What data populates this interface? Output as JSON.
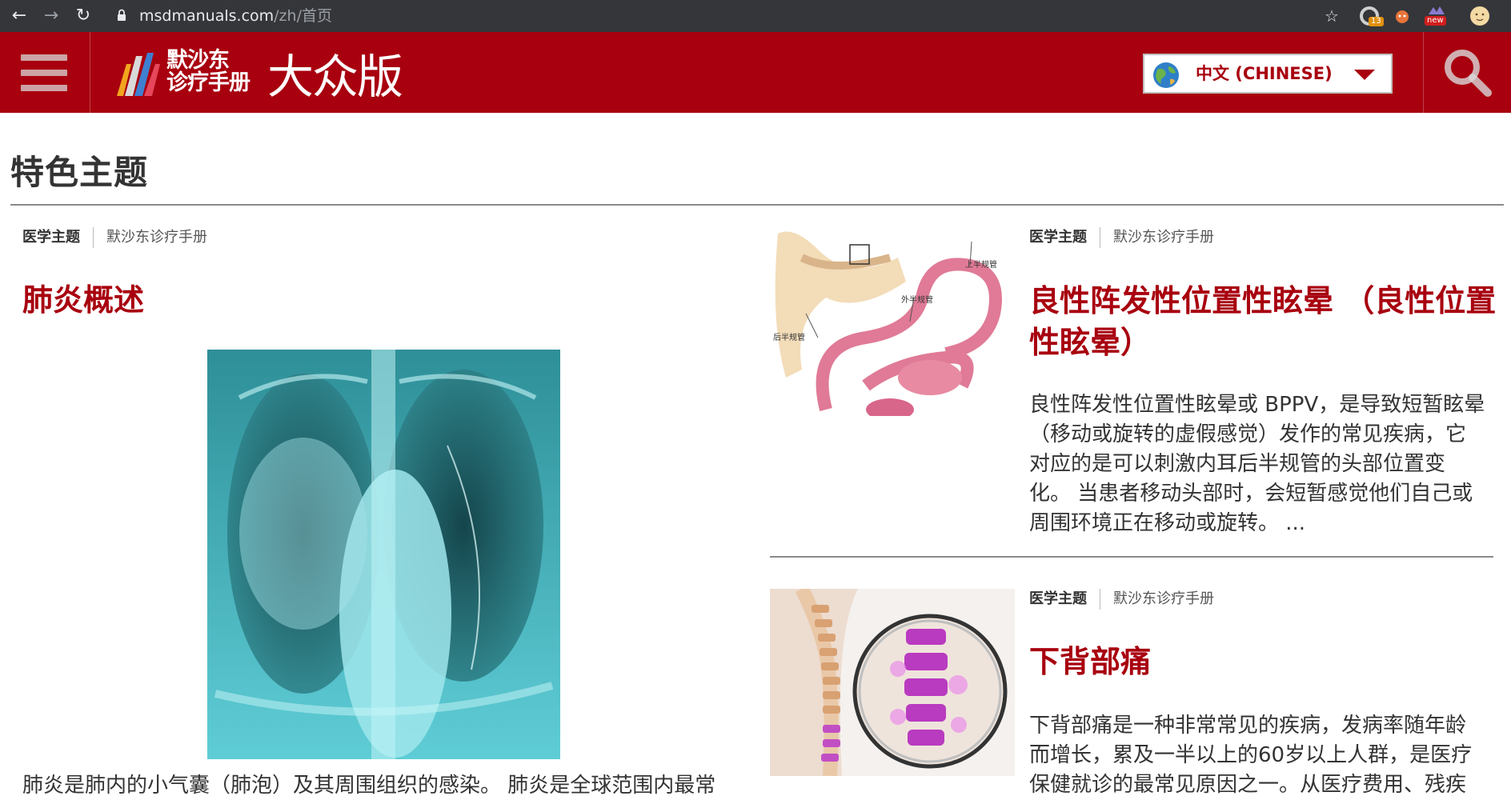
{
  "browser": {
    "url_domain": "msdmanuals.com",
    "url_path": "/zh/首页",
    "extension_badge_count": "13",
    "extension_new_label": "new",
    "icons": [
      "back-arrow-icon",
      "forward-arrow-icon",
      "reload-icon",
      "lock-icon",
      "star-icon",
      "profile-icon"
    ]
  },
  "header": {
    "logo_line1": "默沙东",
    "logo_line2": "诊疗手册",
    "logo_edition": "大众版",
    "language_label": "中文 (CHINESE)",
    "brand_color": "#a8000f"
  },
  "page": {
    "title": "特色主题"
  },
  "articles": [
    {
      "category": "医学主题",
      "source": "默沙东诊疗手册",
      "title": "肺炎概述",
      "summary": "肺炎是肺内的小气囊（肺泡）及其周围组织的感染。 肺炎是全球范围内最常"
    },
    {
      "category": "医学主题",
      "source": "默沙东诊疗手册",
      "title_line1": "良性阵发性位置性眩晕 （良性位置",
      "title_line2": "性眩晕）",
      "summary_lines": [
        "良性阵发性位置性眩晕或 BPPV，是导致短暂眩晕",
        "（移动或旋转的虚假感觉）发作的常见疾病，它",
        "对应的是可以刺激内耳后半规管的头部位置变",
        "化。 当患者移动头部时，会短暂感觉他们自己或",
        "周围环境正在移动或旋转。 ..."
      ],
      "image_labels": [
        "上半规管",
        "外半规管",
        "后半规管"
      ]
    },
    {
      "category": "医学主题",
      "source": "默沙东诊疗手册",
      "title": "下背部痛",
      "summary_lines": [
        "下背部痛是一种非常常见的疾病，发病率随年龄",
        "而增长，累及一半以上的60岁以上人群，是医疗",
        "保健就诊的最常见原因之一。从医疗费用、残疾"
      ]
    }
  ]
}
